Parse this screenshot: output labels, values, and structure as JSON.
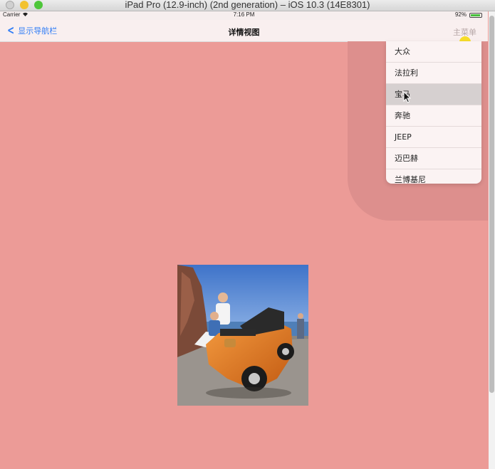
{
  "window": {
    "title": "iPad Pro (12.9-inch) (2nd generation) – iOS 10.3 (14E8301)"
  },
  "status_bar": {
    "carrier": "Carrier",
    "time": "7:16 PM",
    "battery": "92%",
    "battery_level": 0.92
  },
  "nav_bar": {
    "back_label": "显示导航栏",
    "title": "详情视图",
    "menu_label": "主菜单"
  },
  "popover": {
    "items": [
      "大众",
      "法拉利",
      "宝马",
      "奔驰",
      "JEEP",
      "迈巴赫",
      "兰博基尼"
    ],
    "selected_index": 2
  },
  "colors": {
    "background": "#ec9b97",
    "accent": "#2f7cf6"
  }
}
